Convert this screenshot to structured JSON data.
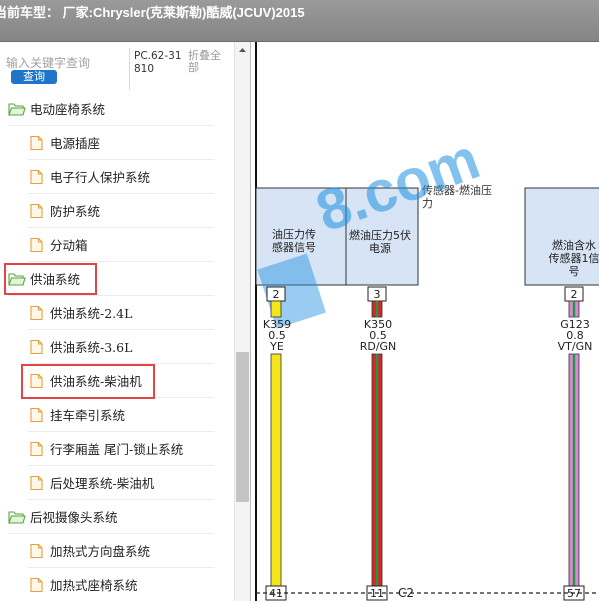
{
  "titlebar": {
    "title": "当前车型：  厂家:Chrysler(克莱斯勒)酷威(JCUV)2015"
  },
  "sidebar": {
    "search": {
      "placeholder": "输入关键字查询",
      "button_label": "查询"
    },
    "doc_code": "PC.62-31810",
    "collapse_all": "折叠全部",
    "items": [
      {
        "label": "电动座椅系统",
        "type": "folder"
      },
      {
        "label": "电源插座",
        "type": "leaf"
      },
      {
        "label": "电子行人保护系统",
        "type": "leaf"
      },
      {
        "label": "防护系统",
        "type": "leaf"
      },
      {
        "label": "分动箱",
        "type": "leaf"
      },
      {
        "label": "供油系统",
        "type": "folder"
      },
      {
        "label": "供油系统-2.4L",
        "type": "leaf"
      },
      {
        "label": "供油系统-3.6L",
        "type": "leaf"
      },
      {
        "label": "供油系统-柴油机",
        "type": "leaf"
      },
      {
        "label": "挂车牵引系统",
        "type": "leaf"
      },
      {
        "label": "行李厢盖 尾门-锁止系统",
        "type": "leaf"
      },
      {
        "label": "后处理系统-柴油机",
        "type": "leaf"
      },
      {
        "label": "后视摄像头系统",
        "type": "folder"
      },
      {
        "label": "加热式方向盘系统",
        "type": "leaf"
      },
      {
        "label": "加热式座椅系统",
        "type": "leaf"
      }
    ],
    "highlighted": [
      "供油系统",
      "供油系统-柴油机"
    ]
  },
  "diagram": {
    "watermark": "8.com",
    "component_label": "传感器-燃油压力",
    "connector_label": "C2",
    "boxes": [
      {
        "text_lines": [
          "油压力传",
          "感器信号"
        ]
      },
      {
        "text_lines": [
          "燃油压力5伏",
          "电源"
        ]
      },
      {
        "text_lines": [
          "燃油含水",
          "传感器1信",
          "号"
        ]
      }
    ],
    "wires": [
      {
        "pin_top": "2",
        "circuit": "K359",
        "gauge": "0.5",
        "color": "YE",
        "pin_bottom": "41",
        "stroke": "#f2e51a",
        "stripe": ""
      },
      {
        "pin_top": "3",
        "circuit": "K350",
        "gauge": "0.5",
        "color": "RD/GN",
        "pin_bottom": "11",
        "stroke": "#d8262a",
        "stripe": "#1e9b3a"
      },
      {
        "pin_top": "2",
        "circuit": "G123",
        "gauge": "0.8",
        "color": "VT/GN",
        "pin_bottom": "57",
        "stroke": "#d989d6",
        "stripe": "#1e9b3a"
      }
    ]
  },
  "colors": {
    "titlebar": "#8f8f8f",
    "search_button": "#1f75c9",
    "highlight_border": "#e24448",
    "component_fill": "#d6e4f6",
    "watermark": "#1e8fe0"
  },
  "icons": {
    "folder": "folder-open-icon",
    "leaf": "document-icon"
  }
}
